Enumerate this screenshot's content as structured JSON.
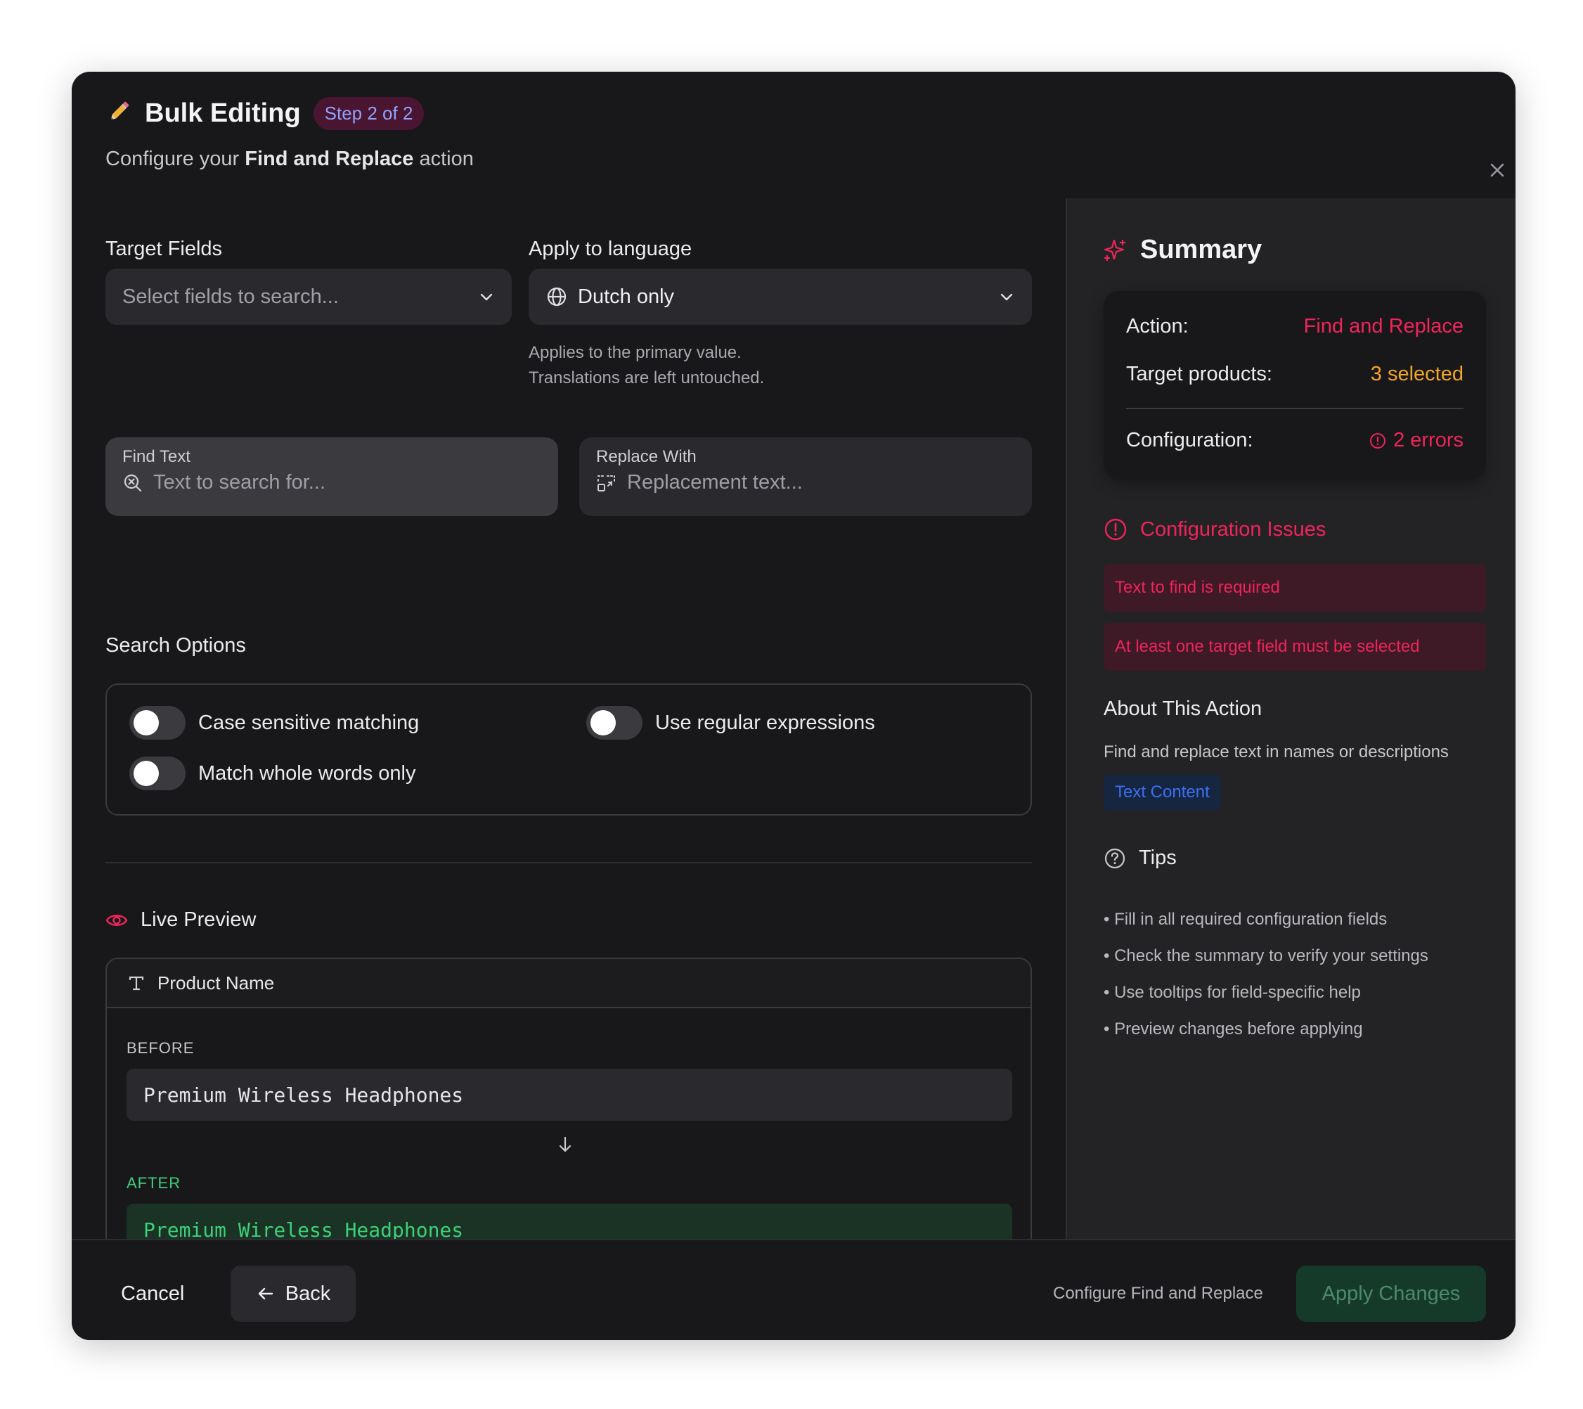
{
  "header": {
    "icon": "pencil-icon",
    "title": "Bulk Editing",
    "step_badge": "Step 2 of 2",
    "subtitle_pre": "Configure your ",
    "subtitle_bold": "Find and Replace",
    "subtitle_post": " action"
  },
  "target_fields": {
    "label": "Target Fields",
    "placeholder": "Select fields to search..."
  },
  "language": {
    "label": "Apply to language",
    "value": "Dutch only",
    "hint_line1": "Applies to the primary value.",
    "hint_line2": "Translations are left untouched."
  },
  "find": {
    "label": "Find Text",
    "placeholder": "Text to search for..."
  },
  "replace": {
    "label": "Replace With",
    "placeholder": "Replacement text..."
  },
  "search_options": {
    "label": "Search Options",
    "case_sensitive": "Case sensitive matching",
    "regex": "Use regular expressions",
    "whole_words": "Match whole words only"
  },
  "live_preview": {
    "label": "Live Preview",
    "field_name": "Product Name",
    "before_label": "BEFORE",
    "before_value": "Premium Wireless Headphones",
    "after_label": "AFTER",
    "after_value": "Premium Wireless Headphones"
  },
  "summary": {
    "title": "Summary",
    "action_label": "Action:",
    "action_value": "Find and Replace",
    "targets_label": "Target products:",
    "targets_value": "3 selected",
    "config_label": "Configuration:",
    "config_value": "2 errors"
  },
  "issues": {
    "title": "Configuration Issues",
    "items": [
      "Text to find is required",
      "At least one target field must be selected"
    ]
  },
  "about": {
    "title": "About This Action",
    "description": "Find and replace text in names or descriptions",
    "tag": "Text Content"
  },
  "tips": {
    "title": "Tips",
    "items": [
      "• Fill in all required configuration fields",
      "• Check the summary to verify your settings",
      "• Use tooltips for field-specific help",
      "• Preview changes before applying"
    ]
  },
  "footer": {
    "cancel": "Cancel",
    "back": "Back",
    "status": "Configure Find and Replace",
    "apply": "Apply Changes"
  },
  "colors": {
    "accent_red": "#f0245a",
    "warning_orange": "#f5a524",
    "success_green": "#3ecf7a",
    "link_blue": "#3b6ff5",
    "badge_text": "#8ea3ff"
  }
}
